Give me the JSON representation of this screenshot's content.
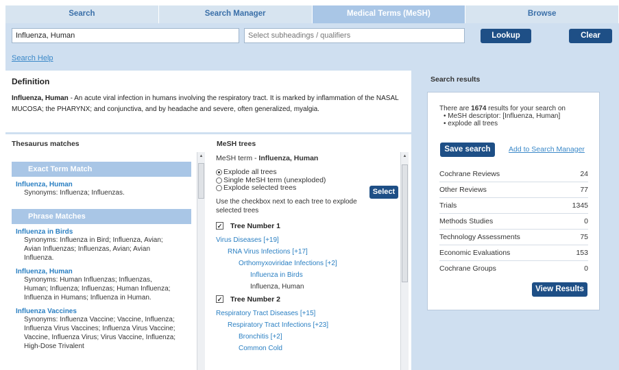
{
  "tabs": [
    {
      "label": "Search",
      "active": false
    },
    {
      "label": "Search Manager",
      "active": false
    },
    {
      "label": "Medical Terms (MeSH)",
      "active": true
    },
    {
      "label": "Browse",
      "active": false
    }
  ],
  "search": {
    "value": "Influenza, Human",
    "qualifier_placeholder": "Select subheadings / qualifiers",
    "lookup_label": "Lookup",
    "clear_label": "Clear",
    "help_link": "Search Help"
  },
  "definition": {
    "heading": "Definition",
    "term": "Influenza, Human",
    "text": " - An acute viral infection in humans involving the respiratory tract. It is marked by inflammation of the NASAL MUCOSA; the PHARYNX; and conjunctiva, and by headache and severe, often generalized, myalgia."
  },
  "thesaurus": {
    "heading": "Thesaurus matches",
    "exact_heading": "Exact Term Match",
    "exact": {
      "term": "Influenza, Human",
      "synonyms": "Synonyms: Influenza; Influenzas."
    },
    "phrase_heading": "Phrase Matches",
    "phrases": [
      {
        "term": "Influenza in Birds",
        "synonyms": "Synonyms: Influenza in Bird; Influenza, Avian; Avian Influenzas; Influenzas, Avian; Avian Influenza."
      },
      {
        "term": "Influenza, Human",
        "synonyms": "Synonyms: Human Influenzas; Influenzas, Human; Influenza; Influenzas; Human Influenza; Influenza in Humans; Influenza in Human."
      },
      {
        "term": "Influenza Vaccines",
        "synonyms": "Synonyms: Influenza Vaccine; Vaccine, Influenza; Influenza Virus Vaccines; Influenza Virus Vaccine; Vaccine, Influenza Virus; Virus Vaccine, Influenza; High-Dose Trivalent"
      }
    ]
  },
  "mesh": {
    "heading": "MeSH trees",
    "term_label": "MeSH term - ",
    "term": "Influenza, Human",
    "options": [
      {
        "label": "Explode all trees",
        "selected": true
      },
      {
        "label": "Single MeSH term (unexploded)",
        "selected": false
      },
      {
        "label": "Explode selected trees",
        "selected": false
      }
    ],
    "select_label": "Select",
    "instructions": "Use the checkbox next to each tree to explode selected trees",
    "tree1_label": "Tree Number 1",
    "tree1": [
      {
        "text": "Virus Diseases [+19]",
        "indent": 0,
        "link": true
      },
      {
        "text": "RNA Virus Infections [+17]",
        "indent": 1,
        "link": true
      },
      {
        "text": "Orthomyxoviridae Infections [+2]",
        "indent": 2,
        "link": true
      },
      {
        "text": "Influenza in Birds",
        "indent": 3,
        "link": true
      },
      {
        "text": "Influenza, Human",
        "indent": 3,
        "link": false
      }
    ],
    "tree2_label": "Tree Number 2",
    "tree2": [
      {
        "text": "Respiratory Tract Diseases [+15]",
        "indent": 0,
        "link": true
      },
      {
        "text": "Respiratory Tract Infections [+23]",
        "indent": 1,
        "link": true
      },
      {
        "text": "Bronchitis [+2]",
        "indent": 2,
        "link": true
      },
      {
        "text": "Common Cold",
        "indent": 2,
        "link": true
      }
    ]
  },
  "results": {
    "heading": "Search results",
    "summary_pre": "There are ",
    "count": "1674",
    "summary_post": " results for your search on",
    "bullets": [
      "MeSH descriptor: [Influenza, Human]",
      "explode all trees"
    ],
    "save_label": "Save search",
    "add_label": "Add to Search Manager",
    "rows": [
      {
        "label": "Cochrane Reviews",
        "value": "24"
      },
      {
        "label": "Other Reviews",
        "value": "77"
      },
      {
        "label": "Trials",
        "value": "1345"
      },
      {
        "label": "Methods Studies",
        "value": "0"
      },
      {
        "label": "Technology Assessments",
        "value": "75"
      },
      {
        "label": "Economic Evaluations",
        "value": "153"
      },
      {
        "label": "Cochrane Groups",
        "value": "0"
      }
    ],
    "view_label": "View Results"
  }
}
